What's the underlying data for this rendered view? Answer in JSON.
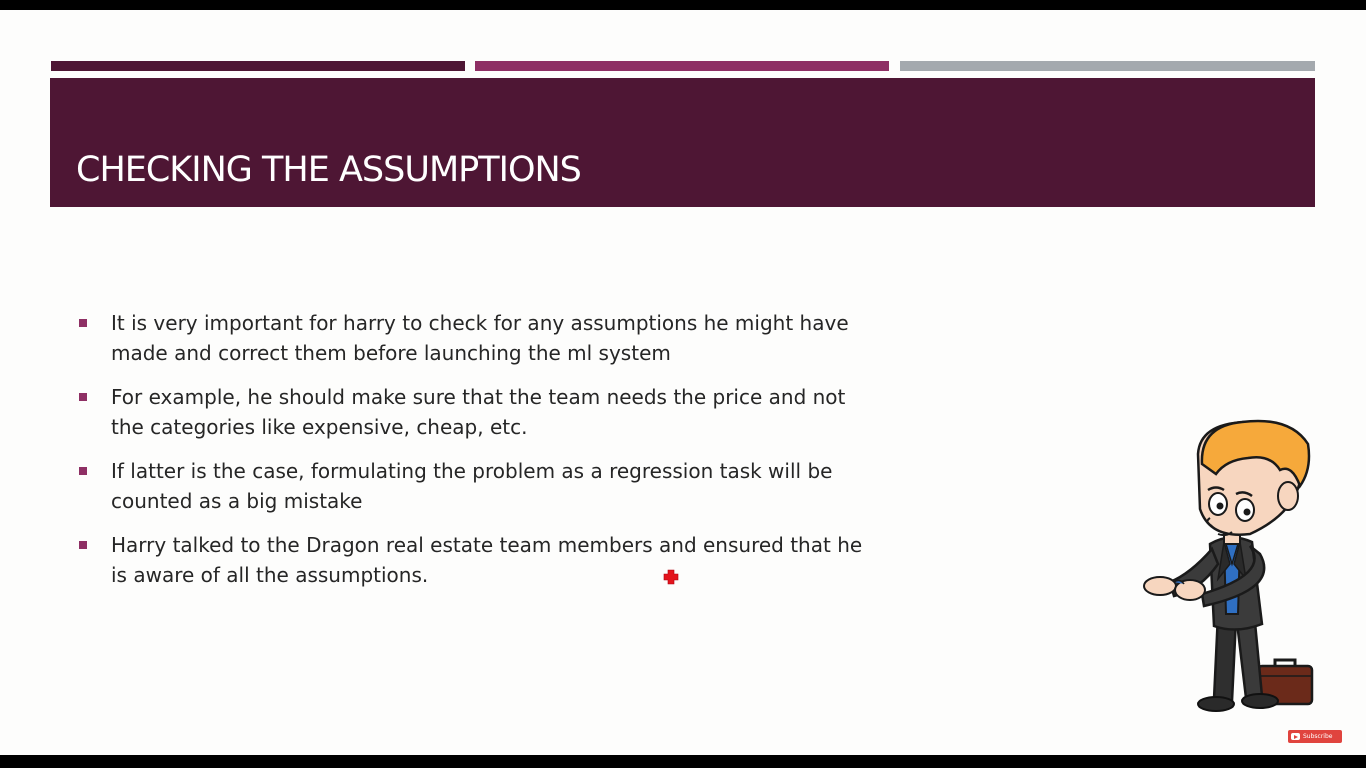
{
  "slide": {
    "title": "CHECKING THE ASSUMPTIONS",
    "bullets": [
      "It is very important for harry to check for any assumptions he might have made and correct them before launching the ml system",
      "For example, he should make sure that the team needs the price and not the categories like expensive, cheap, etc.",
      "If latter is the case, formulating the problem as a regression task will be counted as a big mistake",
      "Harry talked to the Dragon real estate team members and ensured that he is aware of all the assumptions."
    ],
    "colors": {
      "accent_dark": "#4e1634",
      "accent_mid": "#8e2f64",
      "accent_gray": "#a4a9ae"
    }
  },
  "overlay": {
    "subscribe_label": "Subscribe",
    "subscribe_icon": "youtube-icon",
    "cursor_icon": "red-cross-cursor-icon"
  },
  "illustration": {
    "name": "cartoon-businessman-with-briefcase"
  }
}
